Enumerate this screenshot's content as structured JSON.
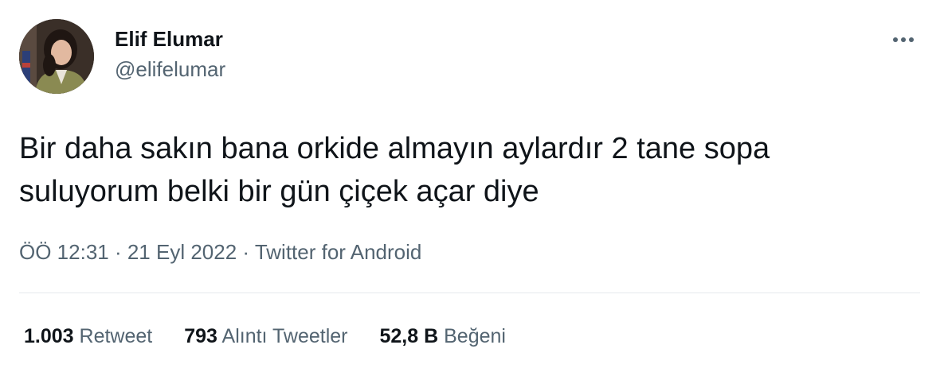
{
  "author": {
    "display_name": "Elif Elumar",
    "handle": "@elifelumar"
  },
  "tweet": {
    "text": "Bir daha sakın bana orkide almayın aylardır 2 tane sopa\nsuluyorum belki bir gün çiçek açar diye"
  },
  "meta": {
    "time": "ÖÖ 12:31",
    "separator": " · ",
    "date": "21 Eyl 2022",
    "source": "Twitter for Android"
  },
  "stats": {
    "retweets": {
      "count": "1.003",
      "label": "Retweet"
    },
    "quotes": {
      "count": "793",
      "label": "Alıntı Tweetler"
    },
    "likes": {
      "count": "52,8 B",
      "label": "Beğeni"
    }
  },
  "icons": {
    "more": "more-horizontal-icon"
  },
  "colors": {
    "primary_text": "#0f1419",
    "secondary_text": "#536471",
    "divider": "#e6e9ec"
  }
}
